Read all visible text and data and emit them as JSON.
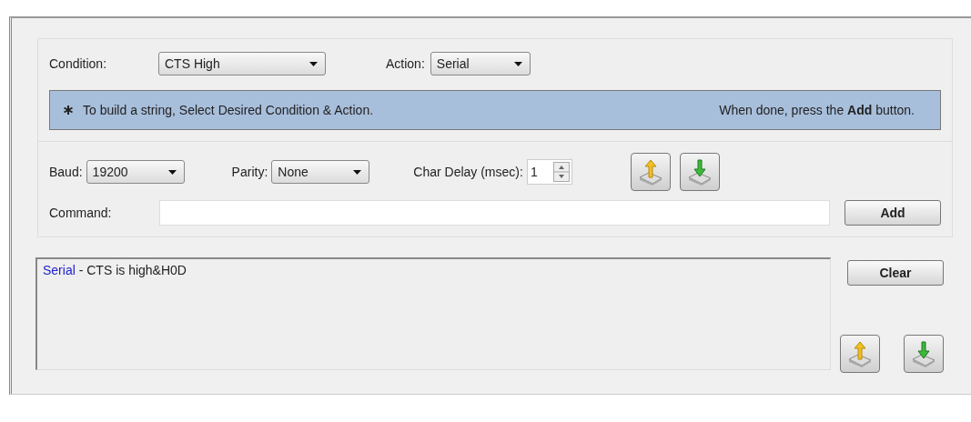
{
  "condition": {
    "label": "Condition:",
    "value": "CTS High"
  },
  "action": {
    "label": "Action:",
    "value": "Serial"
  },
  "hint": {
    "left": "To build a string, Select Desired Condition & Action.",
    "right": "When done, press the **Add** button."
  },
  "baud": {
    "label": "Baud:",
    "value": "19200"
  },
  "parity": {
    "label": "Parity:",
    "value": "None"
  },
  "char_delay": {
    "label": "Char Delay (msec):",
    "value": "1"
  },
  "command": {
    "label": "Command:"
  },
  "add_button": "Add",
  "log": [
    {
      "action": "Serial",
      "text": " - CTS is high&H0D"
    }
  ],
  "clear_button": "Clear"
}
